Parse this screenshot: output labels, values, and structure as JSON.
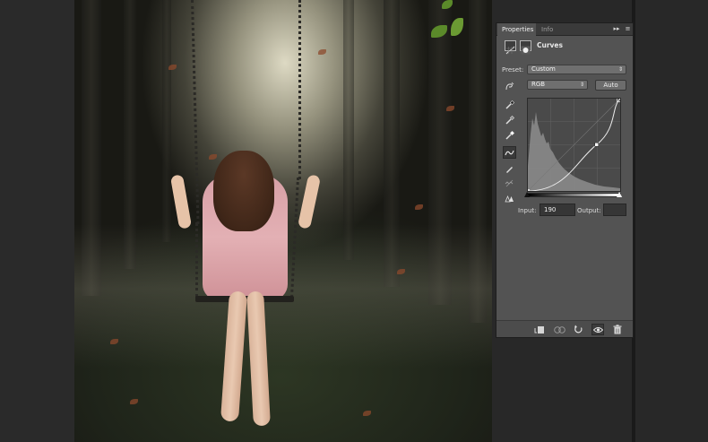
{
  "panel": {
    "tabs": [
      "Properties",
      "Info"
    ],
    "collapse_glyph": "▸▸",
    "menu_glyph": "≡",
    "adjustment_title": "Curves",
    "preset_label": "Preset:",
    "preset_value": "Custom",
    "channel_value": "RGB",
    "auto_label": "Auto",
    "input_label": "Input:",
    "input_value": "190",
    "output_label": "Output:",
    "output_value": ""
  },
  "icons": {
    "tools": [
      "finger-on-image-icon",
      "black-point-eyedropper-icon",
      "gray-point-eyedropper-icon",
      "white-point-eyedropper-icon",
      "curve-points-icon",
      "pencil-icon",
      "smooth-icon",
      "clipping-warning-icon"
    ],
    "bottom": [
      "clip-to-layer-icon",
      "view-previous-icon",
      "reset-icon",
      "visibility-eye-icon",
      "delete-icon"
    ]
  },
  "curve": {
    "points_input": [
      0,
      190,
      255
    ],
    "points_output": [
      0,
      128,
      255
    ]
  },
  "colors": {
    "panel_bg": "#535353",
    "app_bg": "#282828",
    "text": "#dcdcdc"
  }
}
